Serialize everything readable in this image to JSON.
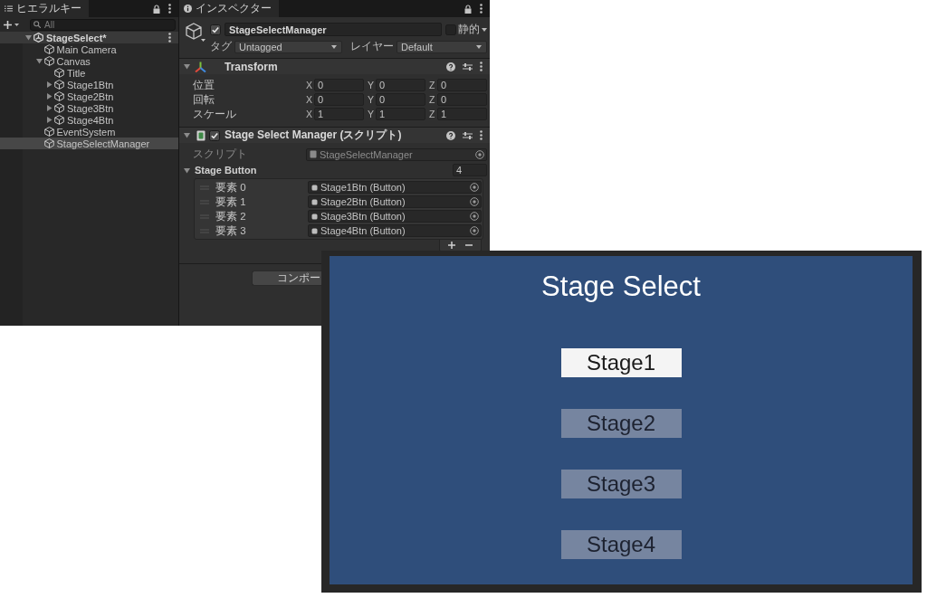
{
  "hierarchy": {
    "tab": "ヒエラルキー",
    "search": {
      "placeholder": "All"
    },
    "tree": [
      {
        "label": "StageSelect*",
        "kind": "scene",
        "expanded": true,
        "selected": false,
        "children": [
          {
            "label": "Main Camera",
            "kind": "gameobject",
            "selected": false
          },
          {
            "label": "Canvas",
            "kind": "gameobject",
            "expanded": true,
            "selected": false,
            "children": [
              {
                "label": "Title",
                "kind": "gameobject",
                "selected": false
              },
              {
                "label": "Stage1Btn",
                "kind": "gameobject",
                "expanded": false,
                "selected": false
              },
              {
                "label": "Stage2Btn",
                "kind": "gameobject",
                "expanded": false,
                "selected": false
              },
              {
                "label": "Stage3Btn",
                "kind": "gameobject",
                "expanded": false,
                "selected": false
              },
              {
                "label": "Stage4Btn",
                "kind": "gameobject",
                "expanded": false,
                "selected": false
              }
            ]
          },
          {
            "label": "EventSystem",
            "kind": "gameobject",
            "selected": false
          },
          {
            "label": "StageSelectManager",
            "kind": "gameobject",
            "selected": true
          }
        ]
      }
    ]
  },
  "inspector": {
    "tab": "インスペクター",
    "object": {
      "active": true,
      "name": "StageSelectManager",
      "static": false,
      "static_label": "静的",
      "tag_label": "タグ",
      "tag": "Untagged",
      "layer_label": "レイヤー",
      "layer": "Default"
    },
    "components": [
      {
        "kind": "transform",
        "title": "Transform",
        "expanded": true,
        "rows": [
          {
            "label": "位置",
            "fields": [
              {
                "axis": "X",
                "value": "0"
              },
              {
                "axis": "Y",
                "value": "0"
              },
              {
                "axis": "Z",
                "value": "0"
              }
            ]
          },
          {
            "label": "回転",
            "fields": [
              {
                "axis": "X",
                "value": "0"
              },
              {
                "axis": "Y",
                "value": "0"
              },
              {
                "axis": "Z",
                "value": "0"
              }
            ]
          },
          {
            "label": "スケール",
            "fields": [
              {
                "axis": "X",
                "value": "1"
              },
              {
                "axis": "Y",
                "value": "1"
              },
              {
                "axis": "Z",
                "value": "1"
              }
            ]
          }
        ]
      },
      {
        "kind": "script",
        "title": "Stage Select Manager (スクリプト)",
        "enabled": true,
        "expanded": true,
        "script_field": {
          "label": "スクリプト",
          "value": "StageSelectManager",
          "disabled": true
        },
        "list": {
          "label": "Stage Button",
          "expanded": true,
          "size": "4",
          "items": [
            {
              "label": "要素 0",
              "value": "Stage1Btn (Button)"
            },
            {
              "label": "要素 1",
              "value": "Stage2Btn (Button)"
            },
            {
              "label": "要素 2",
              "value": "Stage3Btn (Button)"
            },
            {
              "label": "要素 3",
              "value": "Stage4Btn (Button)"
            }
          ]
        }
      }
    ],
    "add_component_button": "コンポー"
  },
  "game_view": {
    "title": "Stage Select",
    "buttons": [
      {
        "label": "Stage1",
        "selected": true
      },
      {
        "label": "Stage2",
        "selected": false
      },
      {
        "label": "Stage3",
        "selected": false
      },
      {
        "label": "Stage4",
        "selected": false
      }
    ]
  }
}
